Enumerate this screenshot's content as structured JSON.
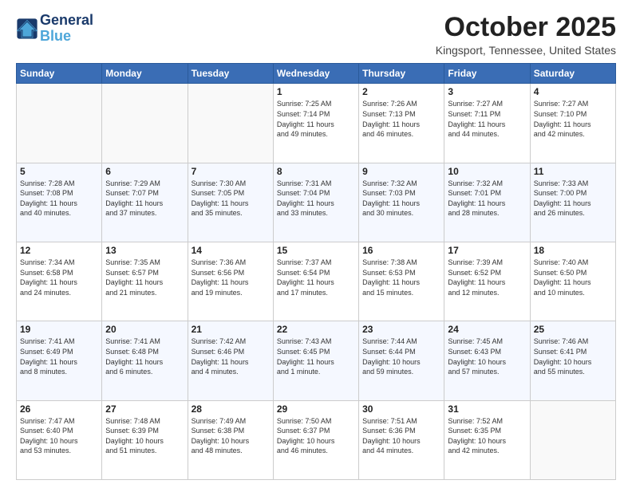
{
  "header": {
    "logo_line1": "General",
    "logo_line2": "Blue",
    "title": "October 2025",
    "subtitle": "Kingsport, Tennessee, United States"
  },
  "days_of_week": [
    "Sunday",
    "Monday",
    "Tuesday",
    "Wednesday",
    "Thursday",
    "Friday",
    "Saturday"
  ],
  "weeks": [
    [
      {
        "day": "",
        "info": ""
      },
      {
        "day": "",
        "info": ""
      },
      {
        "day": "",
        "info": ""
      },
      {
        "day": "1",
        "info": "Sunrise: 7:25 AM\nSunset: 7:14 PM\nDaylight: 11 hours\nand 49 minutes."
      },
      {
        "day": "2",
        "info": "Sunrise: 7:26 AM\nSunset: 7:13 PM\nDaylight: 11 hours\nand 46 minutes."
      },
      {
        "day": "3",
        "info": "Sunrise: 7:27 AM\nSunset: 7:11 PM\nDaylight: 11 hours\nand 44 minutes."
      },
      {
        "day": "4",
        "info": "Sunrise: 7:27 AM\nSunset: 7:10 PM\nDaylight: 11 hours\nand 42 minutes."
      }
    ],
    [
      {
        "day": "5",
        "info": "Sunrise: 7:28 AM\nSunset: 7:08 PM\nDaylight: 11 hours\nand 40 minutes."
      },
      {
        "day": "6",
        "info": "Sunrise: 7:29 AM\nSunset: 7:07 PM\nDaylight: 11 hours\nand 37 minutes."
      },
      {
        "day": "7",
        "info": "Sunrise: 7:30 AM\nSunset: 7:05 PM\nDaylight: 11 hours\nand 35 minutes."
      },
      {
        "day": "8",
        "info": "Sunrise: 7:31 AM\nSunset: 7:04 PM\nDaylight: 11 hours\nand 33 minutes."
      },
      {
        "day": "9",
        "info": "Sunrise: 7:32 AM\nSunset: 7:03 PM\nDaylight: 11 hours\nand 30 minutes."
      },
      {
        "day": "10",
        "info": "Sunrise: 7:32 AM\nSunset: 7:01 PM\nDaylight: 11 hours\nand 28 minutes."
      },
      {
        "day": "11",
        "info": "Sunrise: 7:33 AM\nSunset: 7:00 PM\nDaylight: 11 hours\nand 26 minutes."
      }
    ],
    [
      {
        "day": "12",
        "info": "Sunrise: 7:34 AM\nSunset: 6:58 PM\nDaylight: 11 hours\nand 24 minutes."
      },
      {
        "day": "13",
        "info": "Sunrise: 7:35 AM\nSunset: 6:57 PM\nDaylight: 11 hours\nand 21 minutes."
      },
      {
        "day": "14",
        "info": "Sunrise: 7:36 AM\nSunset: 6:56 PM\nDaylight: 11 hours\nand 19 minutes."
      },
      {
        "day": "15",
        "info": "Sunrise: 7:37 AM\nSunset: 6:54 PM\nDaylight: 11 hours\nand 17 minutes."
      },
      {
        "day": "16",
        "info": "Sunrise: 7:38 AM\nSunset: 6:53 PM\nDaylight: 11 hours\nand 15 minutes."
      },
      {
        "day": "17",
        "info": "Sunrise: 7:39 AM\nSunset: 6:52 PM\nDaylight: 11 hours\nand 12 minutes."
      },
      {
        "day": "18",
        "info": "Sunrise: 7:40 AM\nSunset: 6:50 PM\nDaylight: 11 hours\nand 10 minutes."
      }
    ],
    [
      {
        "day": "19",
        "info": "Sunrise: 7:41 AM\nSunset: 6:49 PM\nDaylight: 11 hours\nand 8 minutes."
      },
      {
        "day": "20",
        "info": "Sunrise: 7:41 AM\nSunset: 6:48 PM\nDaylight: 11 hours\nand 6 minutes."
      },
      {
        "day": "21",
        "info": "Sunrise: 7:42 AM\nSunset: 6:46 PM\nDaylight: 11 hours\nand 4 minutes."
      },
      {
        "day": "22",
        "info": "Sunrise: 7:43 AM\nSunset: 6:45 PM\nDaylight: 11 hours\nand 1 minute."
      },
      {
        "day": "23",
        "info": "Sunrise: 7:44 AM\nSunset: 6:44 PM\nDaylight: 10 hours\nand 59 minutes."
      },
      {
        "day": "24",
        "info": "Sunrise: 7:45 AM\nSunset: 6:43 PM\nDaylight: 10 hours\nand 57 minutes."
      },
      {
        "day": "25",
        "info": "Sunrise: 7:46 AM\nSunset: 6:41 PM\nDaylight: 10 hours\nand 55 minutes."
      }
    ],
    [
      {
        "day": "26",
        "info": "Sunrise: 7:47 AM\nSunset: 6:40 PM\nDaylight: 10 hours\nand 53 minutes."
      },
      {
        "day": "27",
        "info": "Sunrise: 7:48 AM\nSunset: 6:39 PM\nDaylight: 10 hours\nand 51 minutes."
      },
      {
        "day": "28",
        "info": "Sunrise: 7:49 AM\nSunset: 6:38 PM\nDaylight: 10 hours\nand 48 minutes."
      },
      {
        "day": "29",
        "info": "Sunrise: 7:50 AM\nSunset: 6:37 PM\nDaylight: 10 hours\nand 46 minutes."
      },
      {
        "day": "30",
        "info": "Sunrise: 7:51 AM\nSunset: 6:36 PM\nDaylight: 10 hours\nand 44 minutes."
      },
      {
        "day": "31",
        "info": "Sunrise: 7:52 AM\nSunset: 6:35 PM\nDaylight: 10 hours\nand 42 minutes."
      },
      {
        "day": "",
        "info": ""
      }
    ]
  ]
}
